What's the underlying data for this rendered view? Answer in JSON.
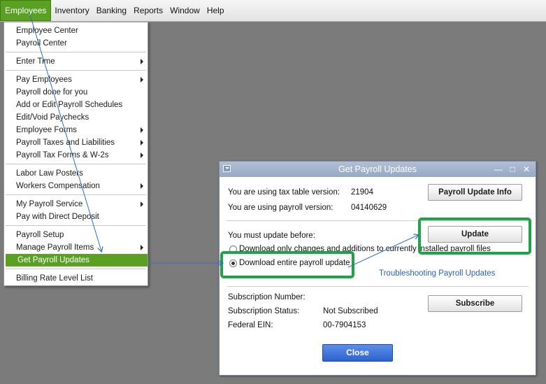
{
  "menubar": {
    "items": [
      {
        "label": "Employees",
        "active": true
      },
      {
        "label": "Inventory"
      },
      {
        "label": "Banking"
      },
      {
        "label": "Reports"
      },
      {
        "label": "Window"
      },
      {
        "label": "Help"
      }
    ]
  },
  "employees_menu": {
    "items": [
      {
        "label": "Employee Center"
      },
      {
        "label": "Payroll Center"
      },
      {
        "label": "Enter Time",
        "submenu": true
      },
      {
        "label": "Pay Employees",
        "submenu": true
      },
      {
        "label": "Payroll done for you"
      },
      {
        "label": "Add or Edit Payroll Schedules"
      },
      {
        "label": "Edit/Void Paychecks"
      },
      {
        "label": "Employee Forms",
        "submenu": true
      },
      {
        "label": "Payroll Taxes and Liabilities",
        "submenu": true
      },
      {
        "label": "Payroll Tax Forms & W-2s",
        "submenu": true
      },
      {
        "label": "Labor Law Posters"
      },
      {
        "label": "Workers Compensation",
        "submenu": true
      },
      {
        "label": "My Payroll Service",
        "submenu": true
      },
      {
        "label": "Pay with Direct Deposit"
      },
      {
        "label": "Payroll Setup"
      },
      {
        "label": "Manage Payroll Items",
        "submenu": true
      },
      {
        "label": "Get Payroll Updates",
        "highlighted": true
      },
      {
        "label": "Billing Rate Level List"
      }
    ]
  },
  "dialog": {
    "title": "Get Payroll Updates",
    "tax_table_label": "You are using tax table version:",
    "tax_table_value": "21904",
    "payroll_version_label": "You are using payroll version:",
    "payroll_version_value": "04140629",
    "payroll_update_info_button": "Payroll Update Info",
    "update_before_label": "You must update before:",
    "update_button": "Update",
    "option_changes_only": "Download only changes and additions to currently installed payroll files",
    "option_entire": "Download entire payroll update",
    "troubleshooting_link": "Troubleshooting Payroll Updates",
    "subscription_number_label": "Subscription Number:",
    "subscription_number_value": "",
    "subscription_status_label": "Subscription Status:",
    "subscription_status_value": "Not Subscribed",
    "federal_ein_label": "Federal EIN:",
    "federal_ein_value": "00-7904153",
    "subscribe_button": "Subscribe",
    "close_button": "Close"
  },
  "colors": {
    "menu_highlight": "#5aa123",
    "annotation_green": "#1fa347",
    "annotation_arrow": "#2f6fc4",
    "close_button": "#2d63d0"
  }
}
